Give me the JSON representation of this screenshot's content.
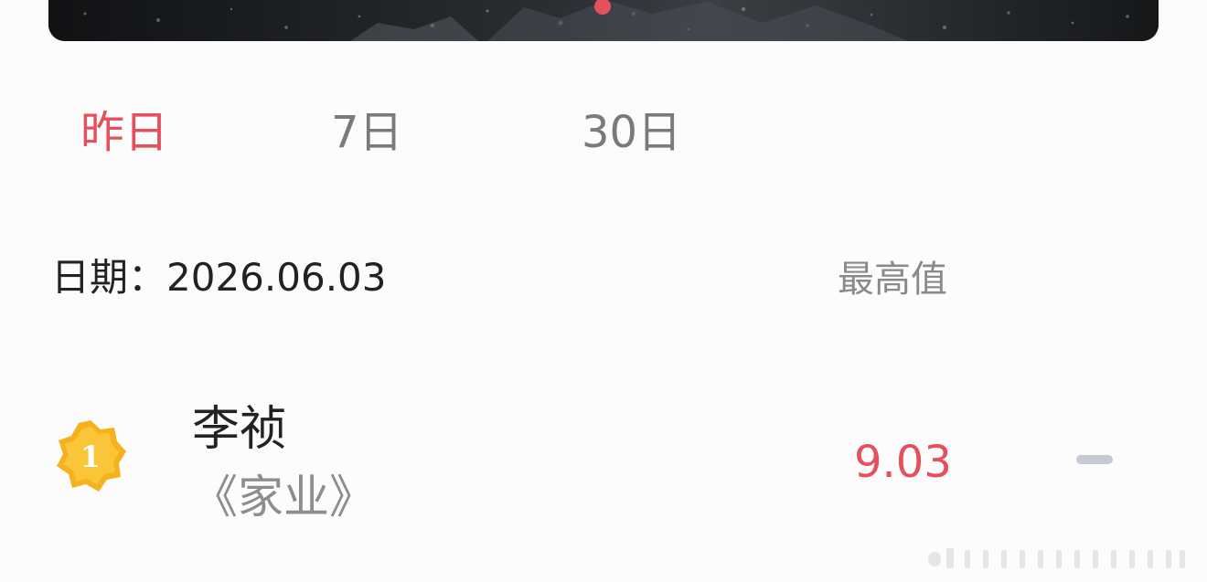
{
  "tabs": [
    {
      "label": "昨日",
      "active": true
    },
    {
      "label": "7日",
      "active": false
    },
    {
      "label": "30日",
      "active": false
    }
  ],
  "date": {
    "label": "日期：",
    "value": "2026.06.03"
  },
  "column_header": "最高值",
  "ranking": [
    {
      "rank": "1",
      "name": "李祯",
      "work": "《家业》",
      "score": "9.03",
      "trend_icon": "dash-icon"
    }
  ],
  "colors": {
    "accent": "#e4505c",
    "badge": "#f6b21c",
    "muted": "#8a8a8a"
  }
}
